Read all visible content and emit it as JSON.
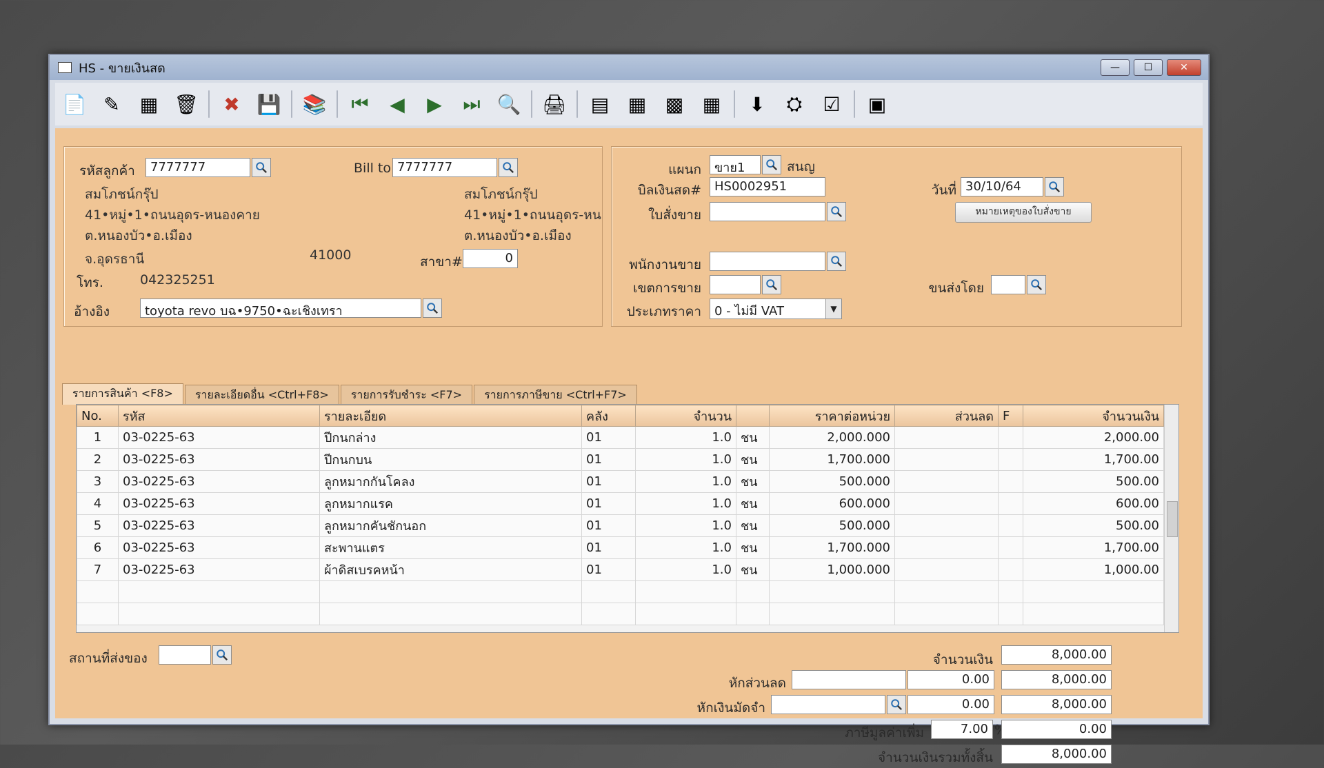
{
  "window": {
    "title": "HS - ขายเงินสด",
    "min_label": "—",
    "max_label": "☐",
    "close_label": "✕"
  },
  "toolbar": [
    "📄",
    "✎",
    "▦",
    "🗑",
    "✖",
    "💾",
    "📚",
    "⏮",
    "◀",
    "▶",
    "⏭",
    "🔍",
    "🖨",
    "▤",
    "▦",
    "▩",
    "▦",
    "⬇",
    "⛭",
    "☑",
    "▣"
  ],
  "customer": {
    "code_label": "รหัสลูกค้า",
    "code": "7777777",
    "name": "สมโภชน์กรุ๊ป",
    "addr1": "41•หมู่•1•ถนนอุดร-หนองคาย",
    "addr2": "ต.หนองบัว•อ.เมือง",
    "addr3": "จ.อุดรธานี",
    "zip": "41000",
    "tel_label": "โทร.",
    "tel": "042325251",
    "ref_label": "อ้างอิง",
    "ref": "toyota revo บฉ•9750•ฉะเชิงเทรา"
  },
  "billto": {
    "label": "Bill to",
    "code": "7777777",
    "name": "สมโภชน์กรุ๊ป",
    "addr1": "41•หมู่•1•ถนนอุดร-หน",
    "addr2": "ต.หนองบัว•อ.เมือง",
    "branch_label": "สาขา#",
    "branch": "0"
  },
  "right": {
    "dept_label": "แผนก",
    "dept": "ขาย1",
    "dept_name": "สนญ",
    "bill_label": "บิลเงินสด#",
    "bill": "HS0002951",
    "date_label": "วันที่",
    "date": "30/10/64",
    "so_label": "ใบสั่งขาย",
    "so": "",
    "so_note_btn": "หมายเหตุของใบสั่งขาย",
    "salesman_label": "พนักงานขาย",
    "salesman": "",
    "area_label": "เขตการขาย",
    "area": "",
    "ship_label": "ขนส่งโดย",
    "ship": "",
    "price_type_label": "ประเภทราคา",
    "price_type": "0 - ไม่มี VAT"
  },
  "tabs": [
    "รายการสินค้า <F8>",
    "รายละเอียดอื่น <Ctrl+F8>",
    "รายการรับชำระ <F7>",
    "รายการภาษีขาย <Ctrl+F7>"
  ],
  "grid": {
    "headers": [
      "No.",
      "รหัส",
      "รายละเอียด",
      "คลัง",
      "จำนวน",
      "",
      "ราคาต่อหน่วย",
      "ส่วนลด",
      "F",
      "จำนวนเงิน"
    ],
    "rows": [
      [
        "1",
        "03-0225-63",
        "ปีกนกล่าง",
        "01",
        "1.0",
        "ชน",
        "2,000.000",
        "",
        "",
        "2,000.00"
      ],
      [
        "2",
        "03-0225-63",
        "ปีกนกบน",
        "01",
        "1.0",
        "ชน",
        "1,700.000",
        "",
        "",
        "1,700.00"
      ],
      [
        "3",
        "03-0225-63",
        "ลูกหมากกันโคลง",
        "01",
        "1.0",
        "ชน",
        "500.000",
        "",
        "",
        "500.00"
      ],
      [
        "4",
        "03-0225-63",
        "ลูกหมากแรค",
        "01",
        "1.0",
        "ชน",
        "600.000",
        "",
        "",
        "600.00"
      ],
      [
        "5",
        "03-0225-63",
        "ลูกหมากคันชักนอก",
        "01",
        "1.0",
        "ชน",
        "500.000",
        "",
        "",
        "500.00"
      ],
      [
        "6",
        "03-0225-63",
        "สะพานแตร",
        "01",
        "1.0",
        "ชน",
        "1,700.000",
        "",
        "",
        "1,700.00"
      ],
      [
        "7",
        "03-0225-63",
        "ผ้าดิสเบรคหน้า",
        "01",
        "1.0",
        "ชน",
        "1,000.000",
        "",
        "",
        "1,000.00"
      ],
      [
        "",
        "",
        "",
        "",
        "",
        "",
        "",
        "",
        "",
        ""
      ],
      [
        "",
        "",
        "",
        "",
        "",
        "",
        "",
        "",
        "",
        ""
      ]
    ]
  },
  "footer": {
    "deliver_label": "สถานที่ส่งของ",
    "deliver": "",
    "amount_label": "จำนวนเงิน",
    "amount": "8,000.00",
    "discount_label": "หักส่วนลด",
    "discount_text": "",
    "discount_val": "0.00",
    "after_discount": "8,000.00",
    "deposit_label": "หักเงินมัดจำ",
    "deposit_text": "",
    "deposit_val": "0.00",
    "after_deposit": "8,000.00",
    "vat_label": "ภาษีมูลค่าเพิ่ม",
    "vat_rate": "7.00",
    "vat_pct": "%",
    "vat_amount": "0.00",
    "total_label": "จำนวนเงินรวมทั้งสิ้น",
    "total": "8,000.00"
  }
}
